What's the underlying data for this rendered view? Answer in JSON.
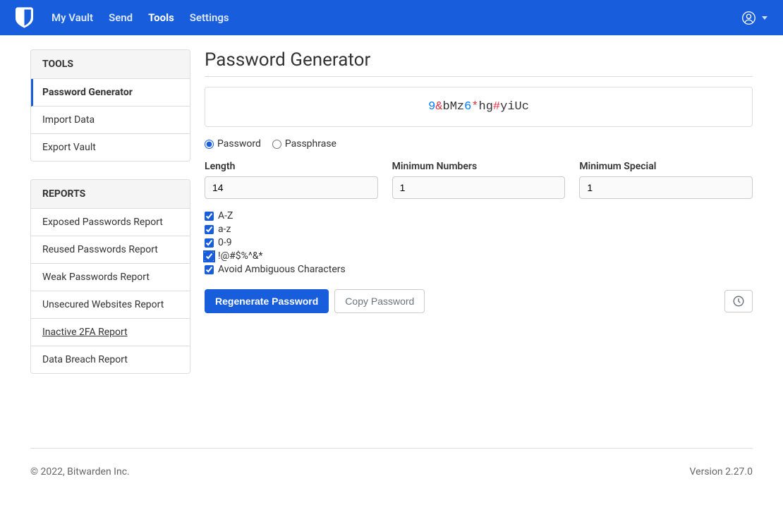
{
  "nav": {
    "items": [
      "My Vault",
      "Send",
      "Tools",
      "Settings"
    ],
    "active_index": 2
  },
  "sidebar": {
    "tools": {
      "header": "TOOLS",
      "items": [
        "Password Generator",
        "Import Data",
        "Export Vault"
      ],
      "active_index": 0
    },
    "reports": {
      "header": "REPORTS",
      "items": [
        "Exposed Passwords Report",
        "Reused Passwords Report",
        "Weak Passwords Report",
        "Unsecured Websites Report",
        "Inactive 2FA Report",
        "Data Breach Report"
      ],
      "underlined_index": 4
    }
  },
  "page": {
    "title": "Password Generator"
  },
  "password": {
    "chars": [
      {
        "c": "9",
        "t": "num"
      },
      {
        "c": "&",
        "t": "special"
      },
      {
        "c": "b",
        "t": "letter"
      },
      {
        "c": "M",
        "t": "letter"
      },
      {
        "c": "z",
        "t": "letter"
      },
      {
        "c": "6",
        "t": "num"
      },
      {
        "c": "*",
        "t": "special"
      },
      {
        "c": "h",
        "t": "letter"
      },
      {
        "c": "g",
        "t": "letter"
      },
      {
        "c": "#",
        "t": "special"
      },
      {
        "c": "y",
        "t": "letter"
      },
      {
        "c": "i",
        "t": "letter"
      },
      {
        "c": "U",
        "t": "letter"
      },
      {
        "c": "c",
        "t": "letter"
      }
    ]
  },
  "type_radio": {
    "password_label": "Password",
    "passphrase_label": "Passphrase",
    "selected": "password"
  },
  "fields": {
    "length": {
      "label": "Length",
      "value": "14"
    },
    "min_numbers": {
      "label": "Minimum Numbers",
      "value": "1"
    },
    "min_special": {
      "label": "Minimum Special",
      "value": "1"
    }
  },
  "checks": {
    "upper": {
      "label": "A-Z",
      "checked": true
    },
    "lower": {
      "label": "a-z",
      "checked": true
    },
    "numbers": {
      "label": "0-9",
      "checked": true
    },
    "special": {
      "label": "!@#$%^&*",
      "checked": true,
      "focused": true
    },
    "ambiguous": {
      "label": "Avoid Ambiguous Characters",
      "checked": true
    }
  },
  "buttons": {
    "regenerate": "Regenerate Password",
    "copy": "Copy Password"
  },
  "footer": {
    "copyright": "© 2022, Bitwarden Inc.",
    "version": "Version 2.27.0"
  }
}
